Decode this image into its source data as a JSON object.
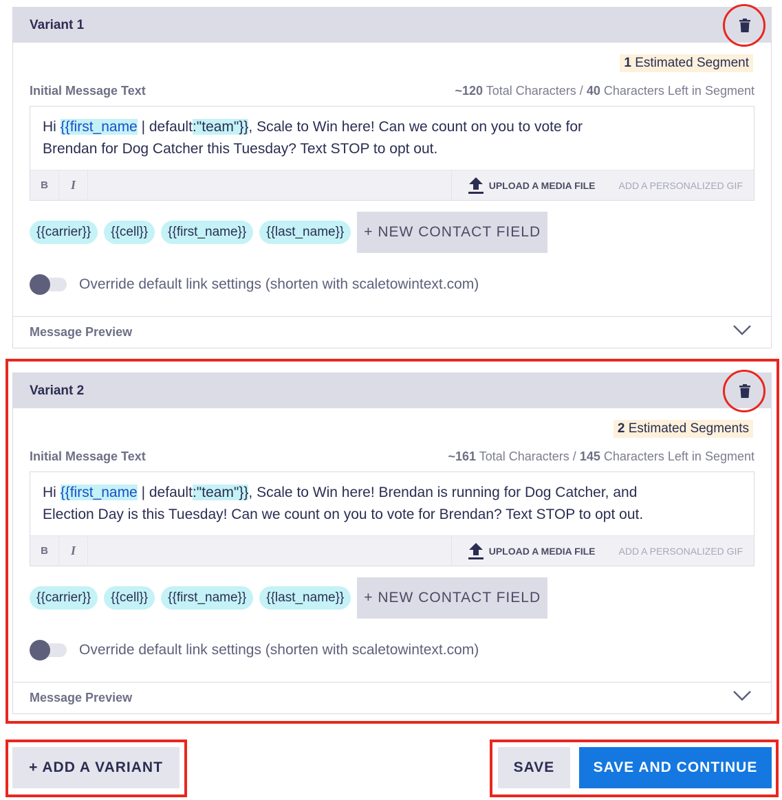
{
  "variants": [
    {
      "title": "Variant 1",
      "segment_count": "1",
      "segment_label": "Estimated Segment",
      "field_label": "Initial Message Text",
      "total_chars": "~120",
      "total_chars_label": "Total Characters /",
      "chars_left": "40",
      "chars_left_label": "Characters Left in Segment",
      "message_prefix": "Hi ",
      "token_name": "{{first_name",
      "token_mid": " | default",
      "token_colon": ":",
      "token_default": "\"team\"}}",
      "message_rest_line1": ", Scale to Win here! Can we count on you to vote for",
      "message_line2": "Brendan for Dog Catcher this Tuesday? Text STOP to opt out.",
      "bold_label": "B",
      "italic_label": "I",
      "upload_label": "UPLOAD A MEDIA FILE",
      "gif_label": "ADD A PERSONALIZED GIF",
      "chips": [
        "{{carrier}}",
        "{{cell}}",
        "{{first_name}}",
        "{{last_name}}"
      ],
      "new_field_label": "+ NEW CONTACT FIELD",
      "toggle_label": "Override default link settings (shorten with scaletowintext.com)",
      "preview_label": "Message Preview"
    },
    {
      "title": "Variant 2",
      "segment_count": "2",
      "segment_label": "Estimated Segments",
      "field_label": "Initial Message Text",
      "total_chars": "~161",
      "total_chars_label": "Total Characters /",
      "chars_left": "145",
      "chars_left_label": "Characters Left in Segment",
      "message_prefix": "Hi ",
      "token_name": "{{first_name",
      "token_mid": " | default",
      "token_colon": ":",
      "token_default": "\"team\"}}",
      "message_rest_line1": ", Scale to Win here! Brendan is running for Dog Catcher, and",
      "message_line2": "Election Day is this Tuesday! Can we count on you to vote for Brendan? Text STOP to opt out.",
      "bold_label": "B",
      "italic_label": "I",
      "upload_label": "UPLOAD A MEDIA FILE",
      "gif_label": "ADD A PERSONALIZED GIF",
      "chips": [
        "{{carrier}}",
        "{{cell}}",
        "{{first_name}}",
        "{{last_name}}"
      ],
      "new_field_label": "+ NEW CONTACT FIELD",
      "toggle_label": "Override default link settings (shorten with scaletowintext.com)",
      "preview_label": "Message Preview"
    }
  ],
  "footer": {
    "add_variant_label": "+ ADD A VARIANT",
    "save_label": "SAVE",
    "save_continue_label": "SAVE AND CONTINUE"
  },
  "colors": {
    "accent_blue": "#1478e0",
    "highlight_red": "#e8271f",
    "token_bg": "#c4f2f6",
    "segment_bg": "#fdf1dc"
  },
  "icons": [
    "trash-icon",
    "upload-icon",
    "chevron-down-icon"
  ]
}
